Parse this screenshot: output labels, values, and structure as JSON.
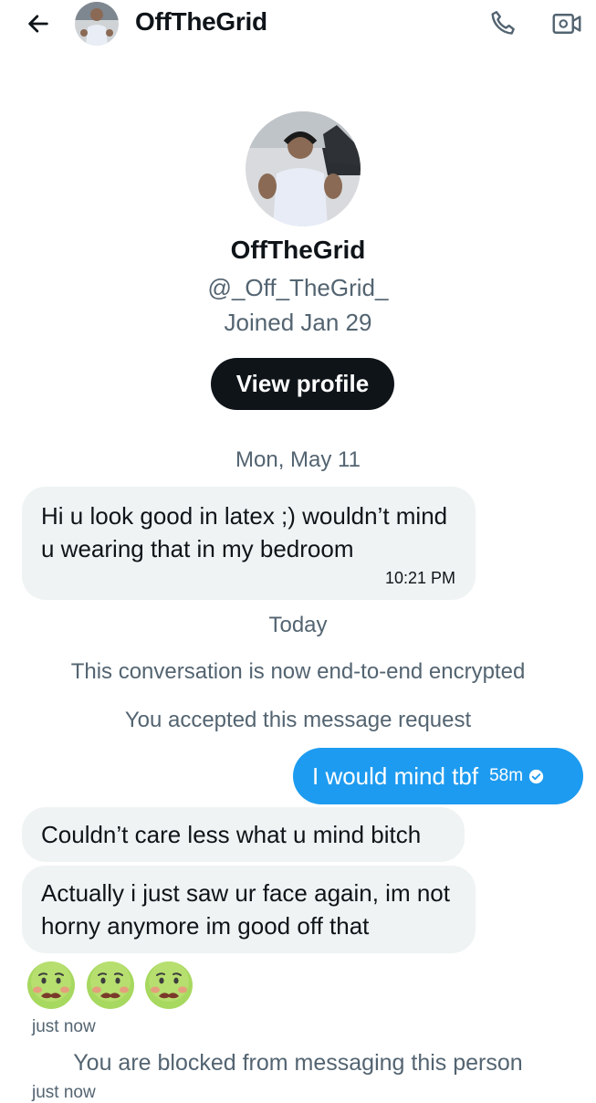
{
  "header": {
    "title": "OffTheGrid",
    "back_icon": "arrow-left-icon",
    "call_icon": "phone-icon",
    "video_icon": "video-camera-icon"
  },
  "profile": {
    "name": "OffTheGrid",
    "handle": "@_Off_TheGrid_",
    "joined": "Joined Jan 29",
    "view_profile_label": "View profile"
  },
  "conversation": {
    "date_1": "Mon, May 11",
    "message_1": {
      "text": "Hi u look good in latex ;) wouldn’t mind u wearing that in my bedroom",
      "time": "10:21 PM"
    },
    "date_2": "Today",
    "system_encrypted": "This conversation is now end-to-end encrypted",
    "system_accepted": "You accepted this message request",
    "message_2": {
      "text": "I would mind tbf",
      "time": "58m",
      "status_icon": "check-circle-icon"
    },
    "message_3": {
      "text": "Couldn’t care less what u mind bitch"
    },
    "message_4": {
      "text": "Actually i just saw ur face again, im not horny anymore im good off that"
    },
    "emoji_icons": [
      "nauseated-face-icon",
      "nauseated-face-icon",
      "nauseated-face-icon"
    ],
    "emoji_time": "just now",
    "system_blocked": "You are blocked from messaging this person",
    "final_time": "just now"
  },
  "colors": {
    "accent": "#1d9bf0",
    "bubble_in": "#eff3f4",
    "secondary_text": "#536471",
    "primary_text": "#0f1419"
  }
}
